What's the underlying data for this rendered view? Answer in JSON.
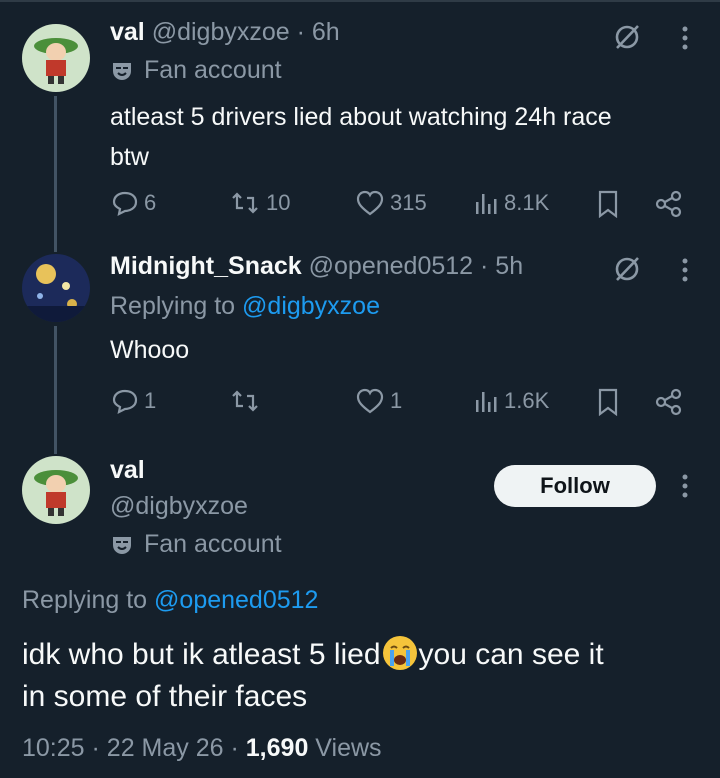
{
  "tweet1": {
    "display_name": "val",
    "handle": "@digbyxzoe",
    "separator": "·",
    "time": "6h",
    "badge_label": "Fan account",
    "text_line1": "atleast 5 drivers lied about watching 24h race",
    "text_line2": "btw",
    "replies": "6",
    "retweets": "10",
    "likes": "315",
    "views": "8.1K"
  },
  "tweet2": {
    "display_name": "Midnight_Snack",
    "handle": "@opened0512",
    "separator": "·",
    "time": "5h",
    "replying_prefix": "Replying to",
    "replying_handle": "@digbyxzoe",
    "text": "Whooo",
    "replies": "1",
    "retweets": "",
    "likes": "1",
    "views": "1.6K"
  },
  "main_tweet": {
    "display_name": "val",
    "handle": "@digbyxzoe",
    "badge_label": "Fan account",
    "follow_label": "Follow",
    "replying_prefix": "Replying to",
    "replying_handle": "@opened0512",
    "text_before_emoji": "idk who but ik atleast 5 lied",
    "emoji": "loudly-crying-face",
    "text_after_emoji": "you can see it",
    "text_line2": "in some of their faces",
    "time": "10:25",
    "date": "22 May 26",
    "separator": "·",
    "views_count": "1,690",
    "views_label": "Views"
  },
  "colors": {
    "background": "#15202b",
    "text": "#f7f9f9",
    "muted": "#8b98a5",
    "link": "#1d9bf0",
    "thread_line": "#425364"
  }
}
